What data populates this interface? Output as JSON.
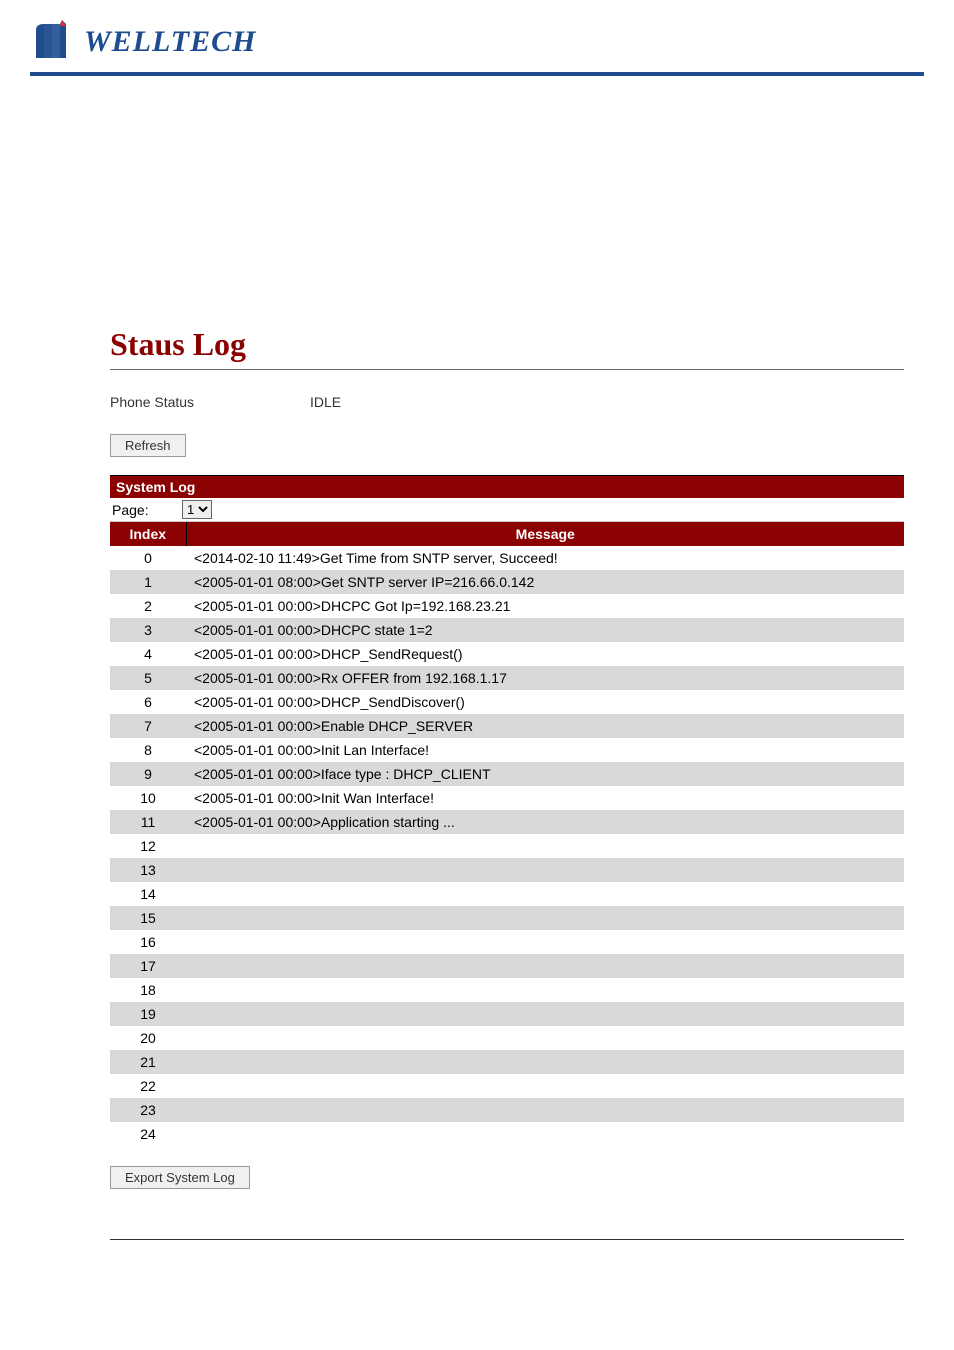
{
  "brand": "WELLTECH",
  "page_title": "Staus Log",
  "phone_status": {
    "label": "Phone Status",
    "value": "IDLE"
  },
  "buttons": {
    "refresh": "Refresh",
    "export": "Export System Log"
  },
  "section_bar": "System Log",
  "page_selector": {
    "label": "Page:",
    "selected": "1",
    "options": [
      "1"
    ]
  },
  "table_headers": {
    "index": "Index",
    "message": "Message"
  },
  "log_rows": [
    {
      "index": "0",
      "message": "<2014-02-10 11:49>Get Time from SNTP server, Succeed!"
    },
    {
      "index": "1",
      "message": "<2005-01-01 08:00>Get SNTP server IP=216.66.0.142"
    },
    {
      "index": "2",
      "message": "<2005-01-01 00:00>DHCPC Got Ip=192.168.23.21"
    },
    {
      "index": "3",
      "message": "<2005-01-01 00:00>DHCPC state 1=2"
    },
    {
      "index": "4",
      "message": "<2005-01-01 00:00>DHCP_SendRequest()"
    },
    {
      "index": "5",
      "message": "<2005-01-01 00:00>Rx OFFER from 192.168.1.17"
    },
    {
      "index": "6",
      "message": "<2005-01-01 00:00>DHCP_SendDiscover()"
    },
    {
      "index": "7",
      "message": "<2005-01-01 00:00>Enable DHCP_SERVER"
    },
    {
      "index": "8",
      "message": "<2005-01-01 00:00>Init Lan Interface!"
    },
    {
      "index": "9",
      "message": "<2005-01-01 00:00>Iface type : DHCP_CLIENT"
    },
    {
      "index": "10",
      "message": "<2005-01-01 00:00>Init Wan Interface!"
    },
    {
      "index": "11",
      "message": "<2005-01-01 00:00>Application starting ..."
    },
    {
      "index": "12",
      "message": ""
    },
    {
      "index": "13",
      "message": ""
    },
    {
      "index": "14",
      "message": ""
    },
    {
      "index": "15",
      "message": ""
    },
    {
      "index": "16",
      "message": ""
    },
    {
      "index": "17",
      "message": ""
    },
    {
      "index": "18",
      "message": ""
    },
    {
      "index": "19",
      "message": ""
    },
    {
      "index": "20",
      "message": ""
    },
    {
      "index": "21",
      "message": ""
    },
    {
      "index": "22",
      "message": ""
    },
    {
      "index": "23",
      "message": ""
    },
    {
      "index": "24",
      "message": ""
    }
  ]
}
